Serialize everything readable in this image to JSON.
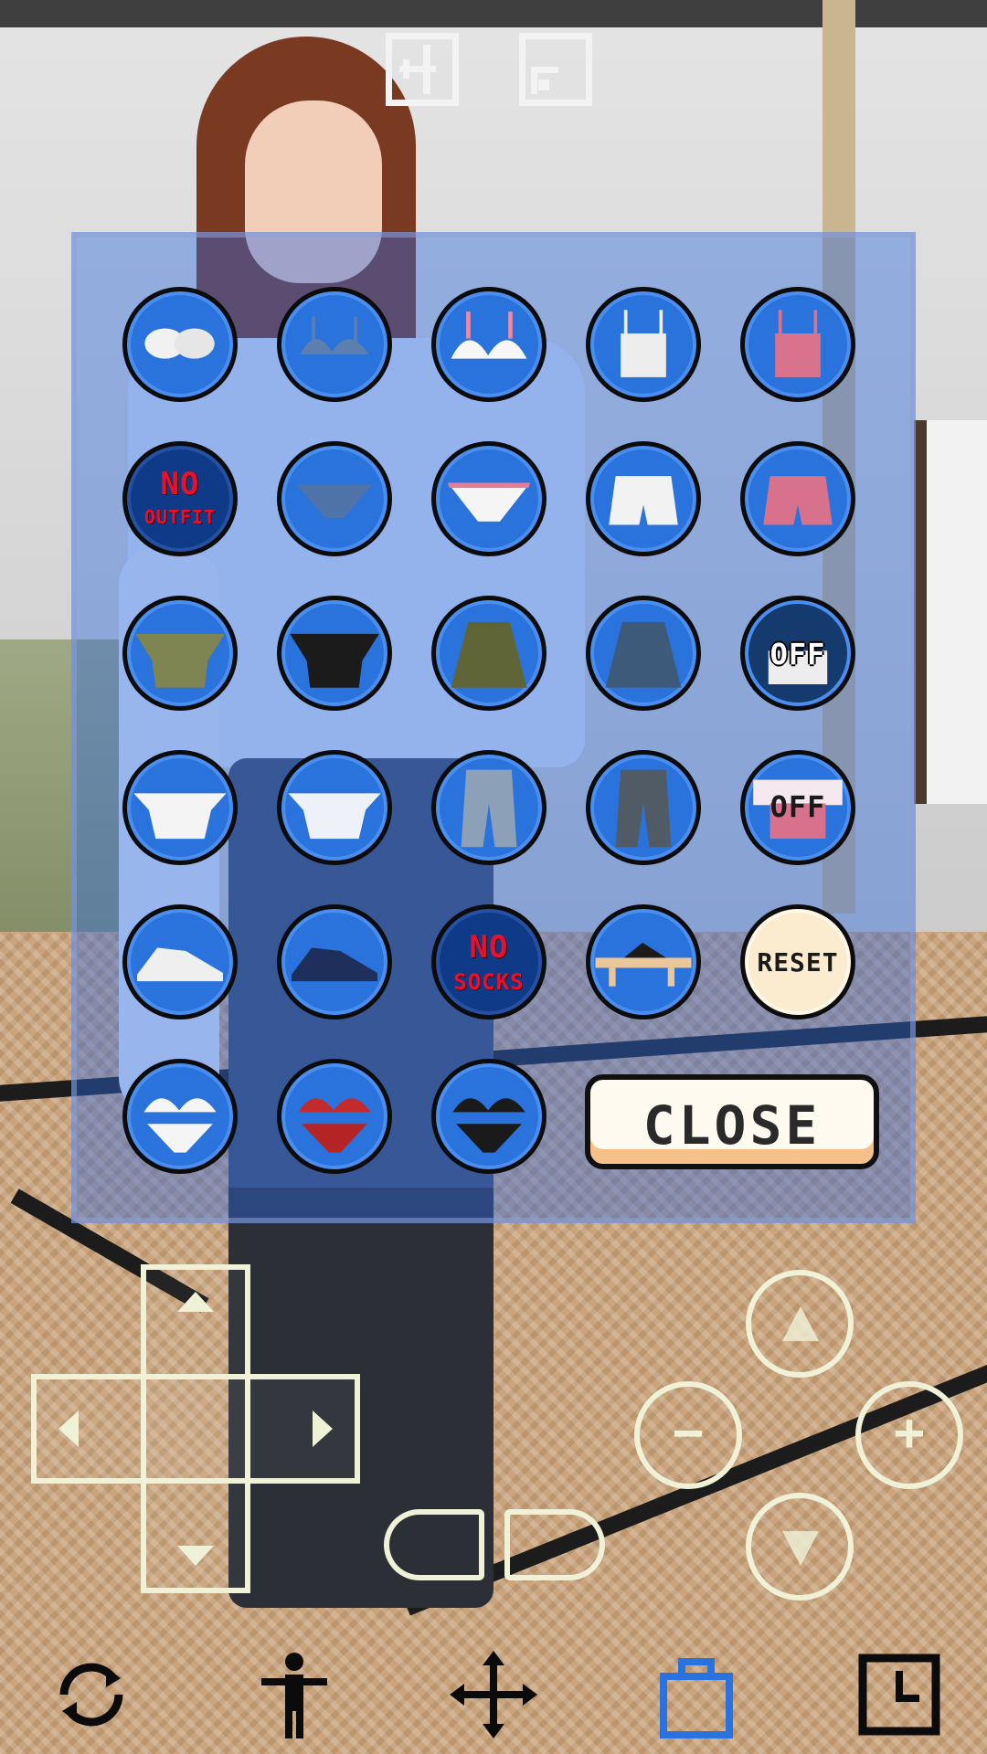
{
  "top_buttons": [
    {
      "name": "exit-icon"
    },
    {
      "name": "window-icon"
    }
  ],
  "outfit_grid": [
    {
      "row": 1,
      "items": [
        {
          "name": "bra-strapless-white",
          "icon": "white-strapless-bra"
        },
        {
          "name": "bra-denim",
          "icon": "denim-bra"
        },
        {
          "name": "bra-white-pink",
          "icon": "white-pink-bra"
        },
        {
          "name": "camisole-white",
          "icon": "white-camisole"
        },
        {
          "name": "camisole-pink",
          "icon": "pink-camisole"
        }
      ]
    },
    {
      "row": 2,
      "items": [
        {
          "name": "no-outfit",
          "icon": "text",
          "label_line1": "NO",
          "label_line2": "OUTFIT"
        },
        {
          "name": "panties-denim",
          "icon": "denim-panties"
        },
        {
          "name": "panties-white-pink",
          "icon": "white-pink-panties"
        },
        {
          "name": "shorts-white",
          "icon": "white-shorts"
        },
        {
          "name": "shorts-pink",
          "icon": "pink-shorts"
        }
      ]
    },
    {
      "row": 3,
      "items": [
        {
          "name": "top-olive",
          "icon": "olive-top"
        },
        {
          "name": "top-black",
          "icon": "black-top"
        },
        {
          "name": "skirt-olive",
          "icon": "olive-skirt"
        },
        {
          "name": "skirt-denim",
          "icon": "denim-skirt"
        },
        {
          "name": "off-white-item",
          "icon": "off-badge",
          "label": "OFF"
        }
      ]
    },
    {
      "row": 4,
      "items": [
        {
          "name": "blouse-white",
          "icon": "white-offshoulder-blouse"
        },
        {
          "name": "blouse-white-2",
          "icon": "white-offshoulder-blouse"
        },
        {
          "name": "jeans-light",
          "icon": "light-jeans"
        },
        {
          "name": "jeans-dark",
          "icon": "dark-jeans"
        },
        {
          "name": "off-pink-item",
          "icon": "off-badge",
          "label": "OFF"
        }
      ]
    },
    {
      "row": 5,
      "items": [
        {
          "name": "sneaker-white",
          "icon": "white-sneaker"
        },
        {
          "name": "sneaker-dark",
          "icon": "dark-sneaker"
        },
        {
          "name": "no-socks",
          "icon": "text",
          "label_line1": "NO",
          "label_line2": "SOCKS"
        },
        {
          "name": "sandals",
          "icon": "geta-sandals"
        },
        {
          "name": "reset",
          "icon": "text",
          "label": "RESET"
        }
      ]
    },
    {
      "row": 6,
      "items": [
        {
          "name": "bikini-white",
          "icon": "white-bikini"
        },
        {
          "name": "bikini-red",
          "icon": "red-bikini"
        },
        {
          "name": "bikini-black",
          "icon": "black-bikini"
        }
      ]
    }
  ],
  "close_button": {
    "label": "CLOSE"
  },
  "controls": {
    "zoom_in": "+",
    "zoom_out": "−"
  },
  "bottom_tabs": [
    {
      "name": "rotate-icon",
      "active": false
    },
    {
      "name": "pose-icon",
      "active": false
    },
    {
      "name": "move-icon",
      "active": false
    },
    {
      "name": "outfit-bag-icon",
      "active": true
    },
    {
      "name": "clock-icon",
      "active": false
    }
  ],
  "colors": {
    "panel": "#2d69e1",
    "item_circle": "#2a73dc",
    "active_tab": "#2a72e0",
    "close_accent": "#f5c08a"
  }
}
